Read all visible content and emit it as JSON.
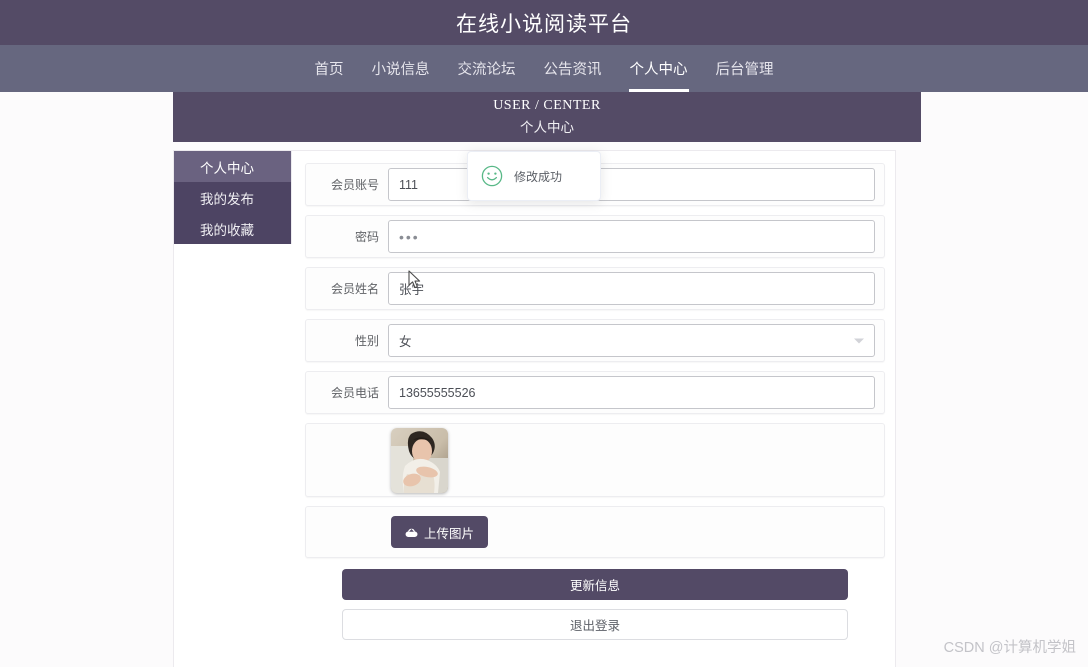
{
  "site": {
    "title": "在线小说阅读平台"
  },
  "nav": {
    "items": [
      {
        "label": "首页",
        "active": false
      },
      {
        "label": "小说信息",
        "active": false
      },
      {
        "label": "交流论坛",
        "active": false
      },
      {
        "label": "公告资讯",
        "active": false
      },
      {
        "label": "个人中心",
        "active": true
      },
      {
        "label": "后台管理",
        "active": false
      }
    ]
  },
  "banner": {
    "english": "USER / CENTER",
    "chinese": "个人中心"
  },
  "sidebar": {
    "items": [
      {
        "label": "个人中心",
        "active": true
      },
      {
        "label": "我的发布",
        "active": false
      },
      {
        "label": "我的收藏",
        "active": false
      }
    ]
  },
  "toast": {
    "message": "修改成功",
    "icon": "smiley-face-icon",
    "accent_color": "#58b887"
  },
  "form": {
    "fields": [
      {
        "label": "会员账号",
        "value": "111",
        "type": "text"
      },
      {
        "label": "密码",
        "value": "•••",
        "type": "password"
      },
      {
        "label": "会员姓名",
        "value": "张宇",
        "type": "text"
      },
      {
        "label": "性别",
        "value": "女",
        "type": "select"
      },
      {
        "label": "会员电话",
        "value": "13655555526",
        "type": "text"
      }
    ],
    "avatar": {
      "alt": "会员头像"
    },
    "upload": {
      "label": "上传图片",
      "icon": "cloud-upload-icon"
    }
  },
  "actions": {
    "update_label": "更新信息",
    "logout_label": "退出登录"
  },
  "watermark": {
    "text": "CSDN @计算机学姐"
  },
  "theme": {
    "title_bar": "#544b66",
    "nav_bar": "#66677f",
    "sidebar": "#4d4463",
    "sidebar_active": "#6a6280",
    "primary_button": "#534a66",
    "page_background": "#fcfbfc"
  }
}
